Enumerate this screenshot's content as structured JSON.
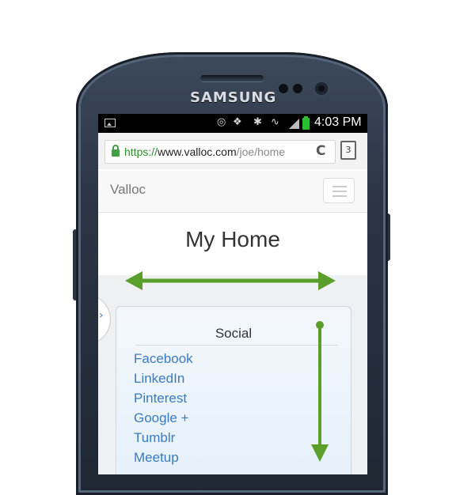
{
  "device": {
    "brand": "SAMSUNG"
  },
  "status_bar": {
    "time": "4:03 PM",
    "icons": [
      "gallery-icon",
      "eye-icon",
      "nfc-icon",
      "bluetooth-icon",
      "wifi-icon",
      "signal-icon",
      "battery-icon"
    ]
  },
  "browser": {
    "url_scheme": "https://",
    "url_host": "www.valloc.com",
    "url_path": "/joe/home",
    "tab_count": "3"
  },
  "navbar": {
    "brand": "Valloc"
  },
  "page": {
    "title": "My Home"
  },
  "panel": {
    "title": "Social",
    "links": [
      "Facebook",
      "LinkedIn",
      "Pinterest",
      "Google +",
      "Tumblr",
      "Meetup"
    ]
  },
  "colors": {
    "arrow": "#5a9e2b",
    "link": "#3a7bbf",
    "battery": "#2ebd2e"
  }
}
